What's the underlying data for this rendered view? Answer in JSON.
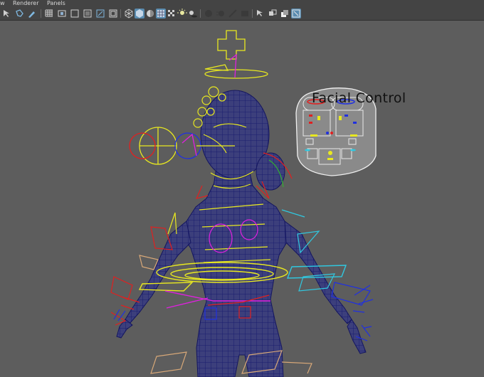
{
  "menu": {
    "view_partial": "w",
    "renderer": "Renderer",
    "panels": "Panels"
  },
  "toolbar_icons": [
    "select-icon",
    "lasso-icon",
    "paint-icon",
    "grid-icon",
    "film-gate-icon",
    "resolution-gate-icon",
    "gate-mask-icon",
    "field-chart-icon",
    "safe-action-icon",
    "wireframe-icon",
    "smooth-shade-icon",
    "default-material-icon",
    "wireframe-on-shaded-icon",
    "textured-icon",
    "lighting-icon",
    "shadows-icon",
    "ambient-occlusion-icon",
    "motion-blur-icon",
    "anti-alias-icon",
    "depth-of-field-icon",
    "isolate-select-icon",
    "xray-icon",
    "xray-joints-icon",
    "xray-active-icon"
  ],
  "scene": {
    "facial_control_label": "Facial Control"
  },
  "colors": {
    "viewport_bg": "#5d5d5d",
    "mesh": "#1c1e7a",
    "control_yellow": "#e8e820",
    "control_red": "#e02020",
    "control_blue": "#2030e0",
    "control_magenta": "#e020e0",
    "control_cyan": "#30c8e0",
    "panel_bg": "#8a8a8a"
  }
}
